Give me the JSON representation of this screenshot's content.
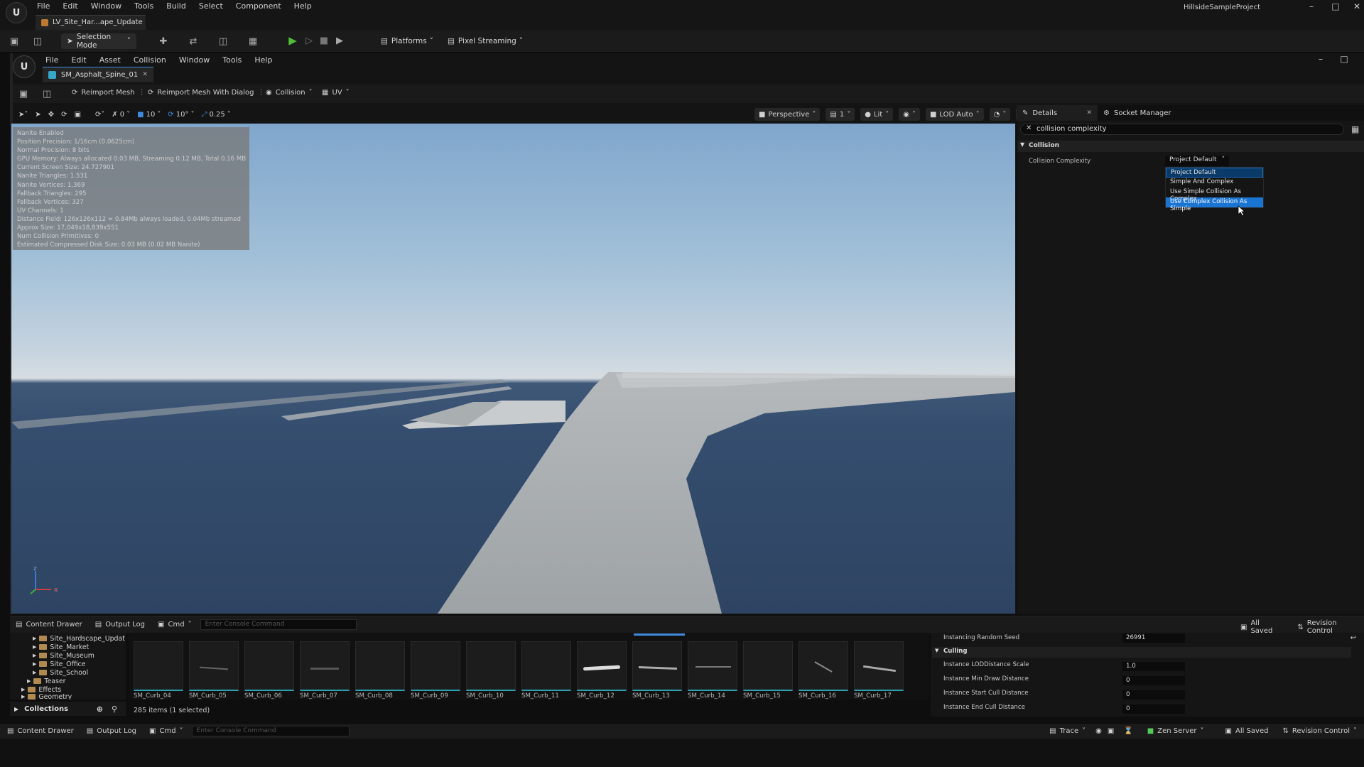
{
  "outer": {
    "menu": [
      "File",
      "Edit",
      "Window",
      "Tools",
      "Build",
      "Select",
      "Component",
      "Help"
    ],
    "level_tab": "LV_Site_Har...ape_Update",
    "project_name": "HillsideSampleProject",
    "window_controls": [
      "–",
      "□",
      "✕"
    ],
    "toolbar": {
      "selection_mode": "Selection Mode",
      "platforms": "Platforms",
      "pixel_streaming": "Pixel Streaming"
    }
  },
  "asset_editor": {
    "menu": [
      "File",
      "Edit",
      "Asset",
      "Collision",
      "Window",
      "Tools",
      "Help"
    ],
    "tab_label": "SM_Asphalt_Spine_01",
    "toolbar": {
      "reimport_mesh": "Reimport Mesh",
      "reimport_with_dialog": "Reimport Mesh With Dialog",
      "collision": "Collision",
      "uv": "UV"
    }
  },
  "viewport_toolbar": {
    "snap_rotation": "0",
    "grid_size": "10",
    "rotation_snap": "10°",
    "scale_snap": "0.25",
    "perspective": "Perspective",
    "camera_speed": "1",
    "view_mode": "Lit",
    "lod": "LOD Auto"
  },
  "stats_overlay": [
    "Nanite Enabled",
    "Position Precision: 1/16cm (0.0625cm)",
    "Normal Precision: 8 bits",
    "GPU Memory: Always allocated 0.03 MB, Streaming 0.12 MB, Total 0.16 MB",
    "Current Screen Size: 24.727901",
    "Nanite Triangles: 1,531",
    "Nanite Vertices: 1,369",
    "Fallback Triangles: 295",
    "Fallback Vertices: 327",
    "UV Channels: 1",
    "Distance Field: 126x126x112 = 0.84Mb always loaded, 0.04Mb streamed",
    "Approx Size: 17,049x18,839x551",
    "Num Collision Primitives: 0",
    "Estimated Compressed Disk Size: 0.03 MB (0.02 MB Nanite)"
  ],
  "details": {
    "tab_details": "Details",
    "tab_socket": "Socket Manager",
    "search_value": "collision complexity",
    "section": "Collision",
    "property_label": "Collision Complexity",
    "property_value": "Project Default",
    "options": [
      "Project Default",
      "Simple And Complex",
      "Use Simple Collision As Complex",
      "Use Complex Collision As Simple"
    ]
  },
  "drawer": {
    "content_drawer": "Content Drawer",
    "output_log": "Output Log",
    "cmd": "Cmd",
    "cmd_placeholder": "Enter Console Command",
    "all_saved": "All Saved",
    "revision_control": "Revision Control",
    "tree": [
      "Site_Hardscape_Updat",
      "Site_Market",
      "Site_Museum",
      "Site_Office",
      "Site_School",
      "Teaser",
      "Effects",
      "Geometry"
    ],
    "collections": "Collections",
    "items_count": "285 items (1 selected)",
    "assets": [
      "SM_Curb_04",
      "SM_Curb_05",
      "SM_Curb_06",
      "SM_Curb_07",
      "SM_Curb_08",
      "SM_Curb_09",
      "SM_Curb_10",
      "SM_Curb_11",
      "SM_Curb_12",
      "SM_Curb_13",
      "SM_Curb_14",
      "SM_Curb_15",
      "SM_Curb_16",
      "SM_Curb_17"
    ]
  },
  "instance_panel": {
    "random_seed_label": "Instancing Random Seed",
    "random_seed_value": "26991",
    "culling_header": "Culling",
    "rows": [
      {
        "label": "Instance LODDistance Scale",
        "value": "1.0"
      },
      {
        "label": "Instance Min Draw Distance",
        "value": "0"
      },
      {
        "label": "Instance Start Cull Distance",
        "value": "0"
      },
      {
        "label": "Instance End Cull Distance",
        "value": "0"
      }
    ]
  },
  "status_bar": {
    "content_drawer": "Content Drawer",
    "output_log": "Output Log",
    "cmd": "Cmd",
    "cmd_placeholder": "Enter Console Command",
    "trace": "Trace",
    "zen_server": "Zen Server",
    "all_saved": "All Saved",
    "revision_control": "Revision Control"
  }
}
